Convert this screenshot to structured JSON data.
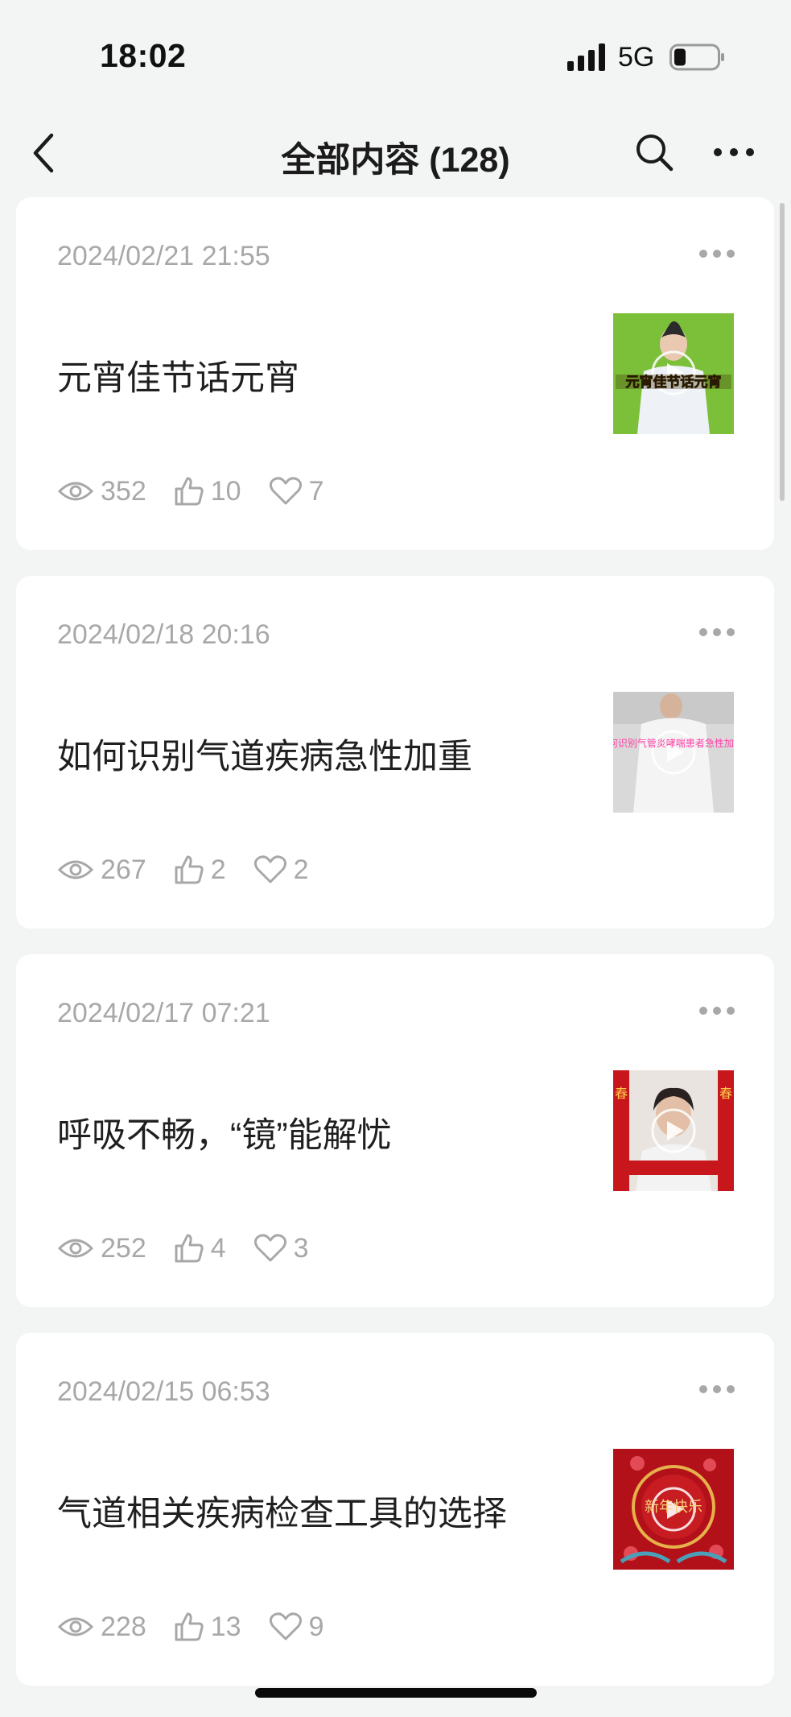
{
  "status_bar": {
    "time": "18:02",
    "network": "5G"
  },
  "nav": {
    "title": "全部内容 (128)"
  },
  "articles": [
    {
      "date": "2024/02/21 21:55",
      "title": "元宵佳节话元宵",
      "thumb_caption": "元宵佳节话元宵",
      "views": "352",
      "likes": "10",
      "favorites": "7"
    },
    {
      "date": "2024/02/18 20:16",
      "title": "如何识别气道疾病急性加重",
      "thumb_caption": "如何识别气管炎哮喘患者急性加重?",
      "views": "267",
      "likes": "2",
      "favorites": "2"
    },
    {
      "date": "2024/02/17 07:21",
      "title": "呼吸不畅，“镜”能解忧",
      "thumb_caption": "春",
      "views": "252",
      "likes": "4",
      "favorites": "3"
    },
    {
      "date": "2024/02/15 06:53",
      "title": "气道相关疾病检查工具的选择",
      "thumb_caption": "新年快乐",
      "views": "228",
      "likes": "13",
      "favorites": "9"
    }
  ]
}
